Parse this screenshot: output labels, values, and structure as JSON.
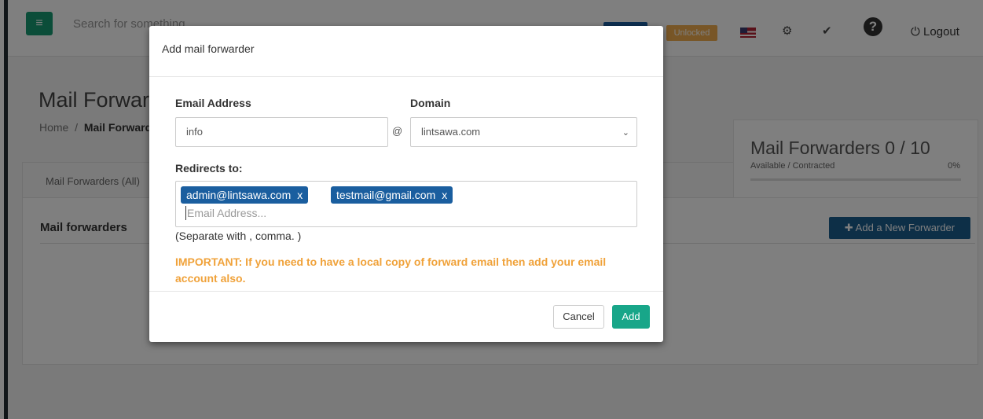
{
  "topbar": {
    "menu_icon": "hamburger-icon",
    "search_placeholder": "Search for something...",
    "status_badge": "Unlocked",
    "flag_icon": "us-flag-icon",
    "settings_icon": "gears-icon",
    "theme_icon": "brush-icon",
    "help_icon": "question-circle-icon",
    "logout_label": "Logout"
  },
  "page": {
    "title": "Mail Forwarders",
    "breadcrumb": {
      "home": "Home",
      "separator": "/",
      "current": "Mail Forwarders"
    }
  },
  "panel": {
    "tab_label": "Mail Forwarders (All)",
    "heading": "Mail forwarders"
  },
  "stats": {
    "title": "Mail Forwarders 0 / 10",
    "sublabel": "Available / Contracted",
    "percent": "0%",
    "progress": 0
  },
  "add_forwarder_button": "Add a New Forwarder",
  "modal": {
    "title": "Add mail forwarder",
    "email_label": "Email Address",
    "email_value": "info",
    "at_sign": "@",
    "domain_label": "Domain",
    "domain_value": "lintsawa.com",
    "redirects_label": "Redirects to:",
    "tags": [
      {
        "email": "admin@lintsawa.com",
        "remove": "x"
      },
      {
        "email": "testmail@gmail.com",
        "remove": "x"
      }
    ],
    "tag_input_placeholder": "Email Address...",
    "help_text": "(Separate with , comma. )",
    "important_text": "IMPORTANT: If you need to have a local copy of forward email then add your email account also.",
    "cancel_label": "Cancel",
    "add_label": "Add"
  },
  "colors": {
    "brand_green": "#169b72",
    "tag_blue": "#1a5e9f",
    "warning_orange": "#f0a23a",
    "add_button": "#18a689"
  }
}
